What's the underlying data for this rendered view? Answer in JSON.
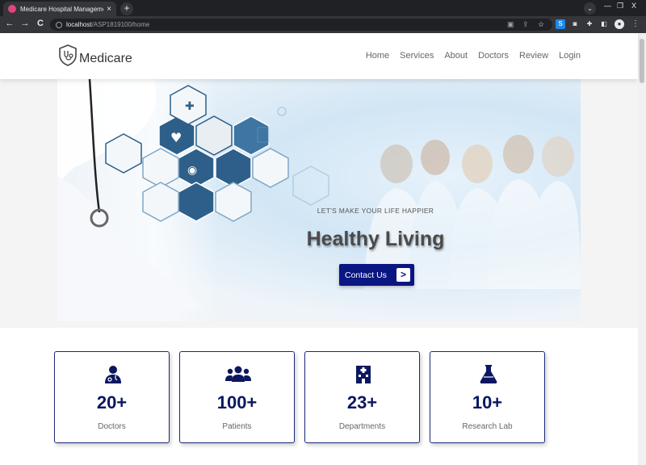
{
  "browser": {
    "tab_title": "Medicare Hospital Management",
    "tab_close": "×",
    "new_tab": "+",
    "url_host": "localhost",
    "url_path": "/ASP1819100/home",
    "back": "←",
    "forward": "→",
    "reload": "C",
    "minimize": "—",
    "restore": "❐",
    "close": "X",
    "tab_search": "⌄",
    "menu": "⋮"
  },
  "header": {
    "brand": "Medicare",
    "nav": [
      "Home",
      "Services",
      "About",
      "Doctors",
      "Review",
      "Login"
    ]
  },
  "hero": {
    "subtitle": "LET'S MAKE YOUR LIFE HAPPIER",
    "title": "Healthy Living",
    "cta_label": "Contact Us",
    "cta_arrow": ">"
  },
  "stats": [
    {
      "icon": "doctor-icon",
      "value": "20+",
      "label": "Doctors"
    },
    {
      "icon": "patients-icon",
      "value": "100+",
      "label": "Patients"
    },
    {
      "icon": "hospital-icon",
      "value": "23+",
      "label": "Departments"
    },
    {
      "icon": "flask-icon",
      "value": "10+",
      "label": "Research Lab"
    }
  ],
  "colors": {
    "brand_navy": "#0a1682",
    "stat_text": "#0b1760",
    "card_border": "#1a2a7a"
  }
}
